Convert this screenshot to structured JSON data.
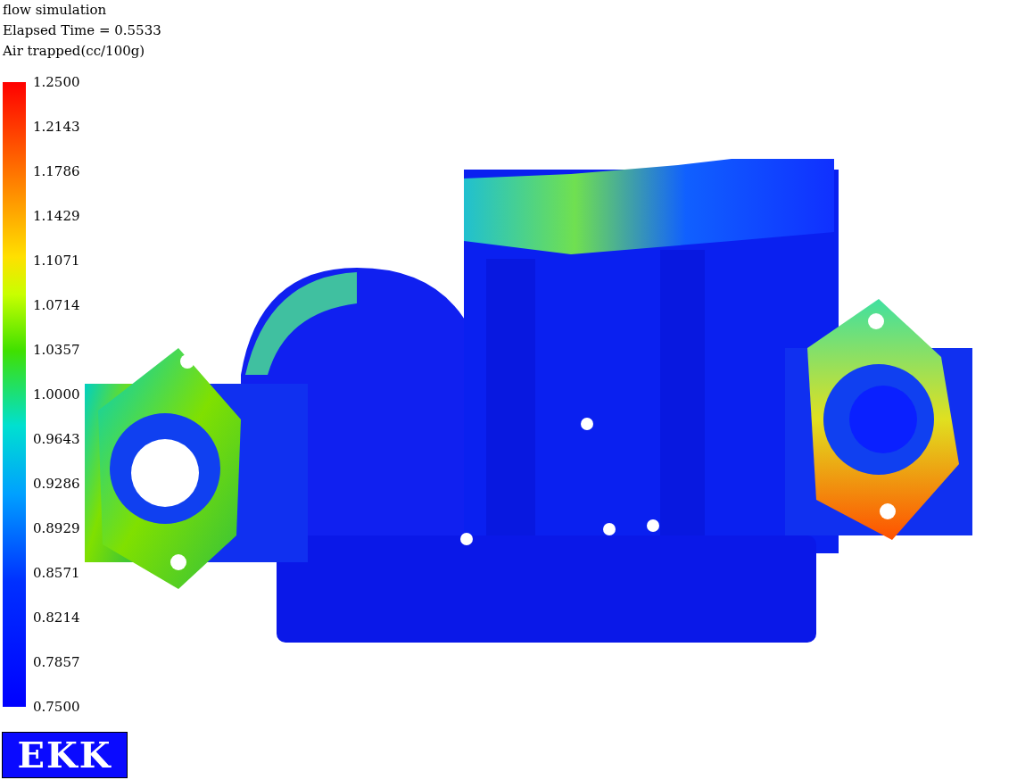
{
  "header": {
    "title": "flow simulation",
    "elapsed_time": "Elapsed Time = 0.5533",
    "quantity": "Air trapped(cc/100g)"
  },
  "legend": {
    "labels": [
      "1.2500",
      "1.2143",
      "1.1786",
      "1.1429",
      "1.1071",
      "1.0714",
      "1.0357",
      "1.0000",
      "0.9643",
      "0.9286",
      "0.8929",
      "0.8571",
      "0.8214",
      "0.7857",
      "0.7500"
    ]
  },
  "logo": {
    "text": "EKK"
  }
}
